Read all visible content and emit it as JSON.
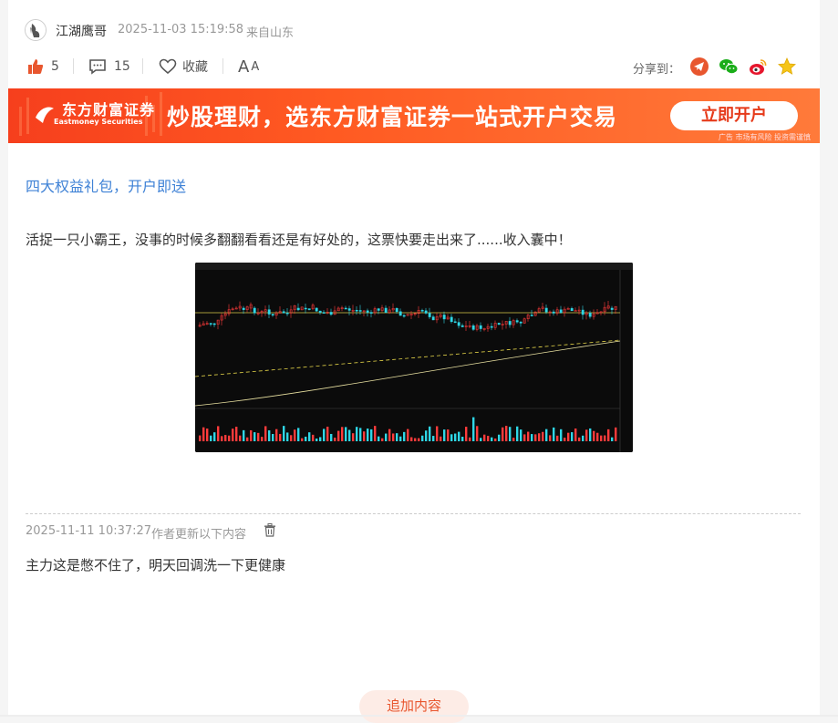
{
  "post": {
    "author": "江湖鹰哥",
    "timestamp": "2025-11-03 15:19:58",
    "location": "来自山东",
    "promo_link": "四大权益礼包，开户即送",
    "body": "活捉一只小霸王，没事的时候多翻翻看看还是有好处的，这票快要走出来了......收入囊中！"
  },
  "actions": {
    "like_count": "5",
    "comment_count": "15",
    "favorite_label": "收藏",
    "font_size_label_big": "A",
    "font_size_label_small": "A",
    "share_label": "分享到："
  },
  "banner": {
    "brand_cn": "东方财富证券",
    "brand_en": "Eastmoney Securities",
    "slogan": "炒股理财，选东方财富证券一站式开户交易",
    "button": "立即开户",
    "ad_note": "广告 市场有风险 投资需谨慎"
  },
  "update": {
    "time": "2025-11-11 10:37:27",
    "label": "作者更新以下内容",
    "text": "主力这是憋不住了，明天回调洗一下更健康"
  },
  "footer": {
    "add_content": "追加内容"
  },
  "colors": {
    "accent": "#e8562e",
    "link": "#3f82d6",
    "banner": "#f63f1d"
  }
}
